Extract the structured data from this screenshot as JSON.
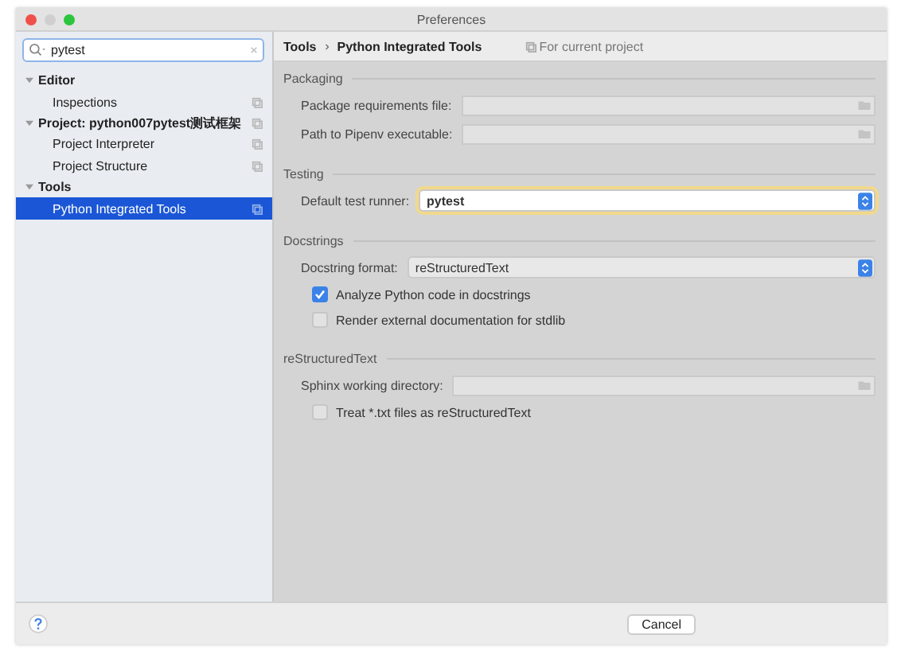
{
  "window": {
    "title": "Preferences"
  },
  "search": {
    "value": "pytest"
  },
  "tree": [
    {
      "label": "Editor",
      "expanded": true,
      "project_scoped": false,
      "selected": false,
      "children": [
        {
          "label": "Inspections",
          "project_scoped": true,
          "selected": false
        }
      ]
    },
    {
      "label": "Project: python007pytest测试框架",
      "expanded": true,
      "project_scoped": true,
      "selected": false,
      "children": [
        {
          "label": "Project Interpreter",
          "project_scoped": true,
          "selected": false
        },
        {
          "label": "Project Structure",
          "project_scoped": true,
          "selected": false
        }
      ]
    },
    {
      "label": "Tools",
      "expanded": true,
      "project_scoped": false,
      "selected": false,
      "children": [
        {
          "label": "Python Integrated Tools",
          "project_scoped": true,
          "selected": true
        }
      ]
    }
  ],
  "breadcrumb": [
    "Tools",
    "Python Integrated Tools"
  ],
  "scope_note": "For current project",
  "sections": [
    {
      "title": "Packaging",
      "rows": [
        {
          "kind": "file",
          "label": "Package requirements file:",
          "value": "",
          "disabled": true
        },
        {
          "kind": "file",
          "label": "Path to Pipenv executable:",
          "value": "",
          "disabled": true
        }
      ]
    },
    {
      "title": "Testing",
      "rows": [
        {
          "kind": "select",
          "label": "Default test runner:",
          "value": "pytest",
          "focused": true
        }
      ]
    },
    {
      "title": "Docstrings",
      "rows": [
        {
          "kind": "select",
          "label": "Docstring format:",
          "value": "reStructuredText",
          "focused": false
        },
        {
          "kind": "checkbox",
          "label": "Analyze Python code in docstrings",
          "checked": true
        },
        {
          "kind": "checkbox",
          "label": "Render external documentation for stdlib",
          "checked": false
        }
      ]
    },
    {
      "title": "reStructuredText",
      "rows": [
        {
          "kind": "file",
          "label": "Sphinx working directory:",
          "value": "",
          "disabled": true
        },
        {
          "kind": "checkbox",
          "label": "Treat *.txt files as reStructuredText",
          "checked": false
        }
      ]
    }
  ],
  "buttons": [
    "Cancel"
  ]
}
